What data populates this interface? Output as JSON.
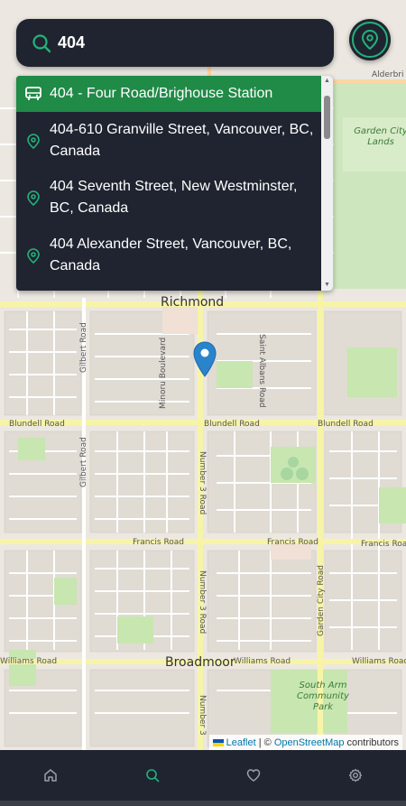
{
  "search": {
    "value": "404",
    "placeholder": ""
  },
  "suggestions": [
    {
      "label": "404 - Four Road/Brighouse Station",
      "icon": "bus-icon",
      "active": true
    },
    {
      "label": "404-610 Granville Street, Vancouver, BC, Canada",
      "icon": "location-pin-icon",
      "active": false
    },
    {
      "label": "404 Seventh Street, New Westminster, BC, Canada",
      "icon": "location-pin-icon",
      "active": false
    },
    {
      "label": "404 Alexander Street, Vancouver, BC, Canada",
      "icon": "location-pin-icon",
      "active": false
    }
  ],
  "map": {
    "city_label": "Richmond",
    "neighborhood_label": "Broadmoor",
    "park_labels": [
      "Garden City Lands",
      "South Arm Community Park"
    ],
    "street_labels": {
      "blundell_left": "Blundell Road",
      "blundell_mid": "Blundell Road",
      "blundell_right": "Blundell Road",
      "francis_mid": "Francis Road",
      "francis_right1": "Francis Road",
      "francis_right2": "Francis Road",
      "williams_left": "Williams Road",
      "williams_mid": "Williams Road",
      "williams_right": "Williams Road",
      "gilbert_top": "Gilbert Road",
      "gilbert_bottom": "Gilbert Road",
      "minoru": "Minoru Boulevard",
      "saint_albans": "Saint Albans Road",
      "number3_a": "Number 3 Road",
      "number3_b": "Number 3 Road",
      "number3_c": "Number 3",
      "garden_city": "Garden City Road",
      "alderbridge": "Alderbri"
    }
  },
  "attribution": {
    "leaflet": "Leaflet",
    "separator": " | © ",
    "osm": "OpenStreetMap",
    "suffix": " contributors"
  },
  "nav": [
    {
      "name": "home-icon",
      "active": false
    },
    {
      "name": "search-icon",
      "active": true
    },
    {
      "name": "heart-icon",
      "active": false
    },
    {
      "name": "gear-icon",
      "active": false
    }
  ],
  "colors": {
    "accent": "#23b27a",
    "active_row": "#208a47",
    "panel": "#1f2430",
    "pin": "#2a84cc"
  }
}
